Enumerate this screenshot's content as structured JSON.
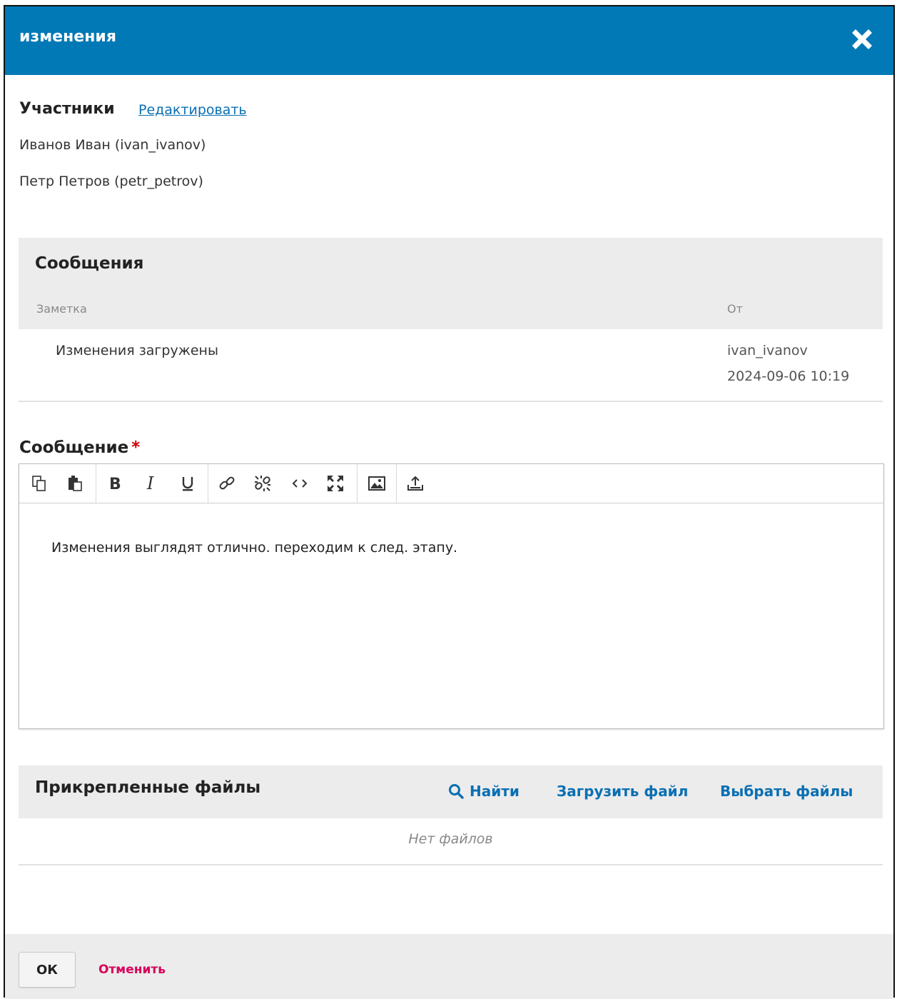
{
  "dialog": {
    "title": "изменения",
    "close_icon": "close-icon"
  },
  "participants": {
    "heading": "Участники",
    "edit_label": "Редактировать",
    "items": [
      "Иванов Иван (ivan_ivanov)",
      "Петр Петров (petr_petrov)"
    ]
  },
  "messages": {
    "title": "Сообщения",
    "columns": {
      "note": "Заметка",
      "from": "От"
    },
    "rows": [
      {
        "note": "Изменения загружены",
        "user": "ivan_ivanov",
        "date": "2024-09-06 10:19"
      }
    ]
  },
  "compose": {
    "label": "Сообщение",
    "required_mark": "*",
    "toolbar_icons": [
      "copy-icon",
      "paste-icon",
      "bold-icon",
      "italic-icon",
      "underline-icon",
      "link-icon",
      "unlink-icon",
      "code-icon",
      "fullscreen-icon",
      "image-icon",
      "upload-icon"
    ],
    "body": "Изменения выглядят отлично. переходим к след. этапу."
  },
  "files": {
    "title": "Прикрепленные файлы",
    "search_label": "Найти",
    "upload_label": "Загрузить файл",
    "select_label": "Выбрать файлы",
    "empty_text": "Нет файлов"
  },
  "footer": {
    "ok_label": "ОК",
    "cancel_label": "Отменить"
  },
  "colors": {
    "header": "#0079b6",
    "link": "#0a6fb3",
    "cancel": "#d8005a",
    "panel": "#ececec"
  }
}
